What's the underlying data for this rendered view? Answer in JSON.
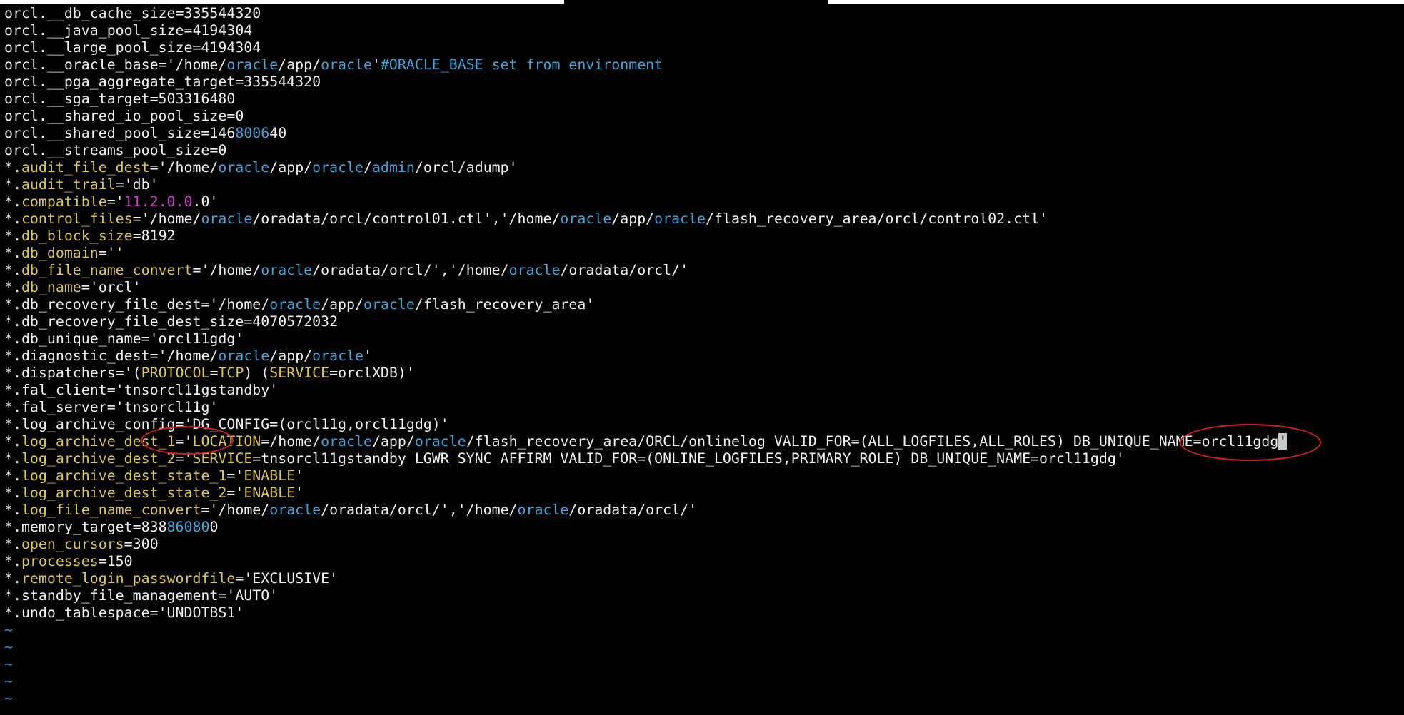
{
  "lines": [
    {
      "segments": [
        {
          "t": "orcl.__db_cache_size=335544320",
          "c": "w"
        }
      ]
    },
    {
      "segments": [
        {
          "t": "orcl.__java_pool_size=4194304",
          "c": "w"
        }
      ]
    },
    {
      "segments": [
        {
          "t": "orcl.__large_pool_size=4194304",
          "c": "w"
        }
      ]
    },
    {
      "segments": [
        {
          "t": "orcl.__oracle_base='/home/",
          "c": "w"
        },
        {
          "t": "oracle",
          "c": "c"
        },
        {
          "t": "/app/",
          "c": "w"
        },
        {
          "t": "oracle",
          "c": "c"
        },
        {
          "t": "'",
          "c": "w"
        },
        {
          "t": "#ORACLE_BASE set from environment",
          "c": "c"
        }
      ]
    },
    {
      "segments": [
        {
          "t": "orcl.__pga_aggregate_target=335544320",
          "c": "w"
        }
      ]
    },
    {
      "segments": [
        {
          "t": "orcl.__sga_target=503316480",
          "c": "w"
        }
      ]
    },
    {
      "segments": [
        {
          "t": "orcl.__shared_io_pool_size=0",
          "c": "w"
        }
      ]
    },
    {
      "segments": [
        {
          "t": "orcl.__shared_pool_size=146",
          "c": "w"
        },
        {
          "t": "8006",
          "c": "c"
        },
        {
          "t": "40",
          "c": "w"
        }
      ]
    },
    {
      "segments": [
        {
          "t": "orcl.__streams_pool_size=0",
          "c": "w"
        }
      ]
    },
    {
      "segments": [
        {
          "t": "*.",
          "c": "w"
        },
        {
          "t": "audit_file_dest",
          "c": "y"
        },
        {
          "t": "='/home/",
          "c": "w"
        },
        {
          "t": "oracle",
          "c": "c"
        },
        {
          "t": "/app/",
          "c": "w"
        },
        {
          "t": "oracle",
          "c": "c"
        },
        {
          "t": "/",
          "c": "w"
        },
        {
          "t": "admin",
          "c": "c"
        },
        {
          "t": "/orcl/adump'",
          "c": "w"
        }
      ]
    },
    {
      "segments": [
        {
          "t": "*.",
          "c": "w"
        },
        {
          "t": "audit_trail",
          "c": "y"
        },
        {
          "t": "='db'",
          "c": "w"
        }
      ]
    },
    {
      "segments": [
        {
          "t": "*.",
          "c": "w"
        },
        {
          "t": "compatible",
          "c": "y"
        },
        {
          "t": "='",
          "c": "w"
        },
        {
          "t": "11.2.0.0",
          "c": "m"
        },
        {
          "t": ".0'",
          "c": "w"
        }
      ]
    },
    {
      "segments": [
        {
          "t": "*.",
          "c": "w"
        },
        {
          "t": "control_files",
          "c": "y"
        },
        {
          "t": "='/home/",
          "c": "w"
        },
        {
          "t": "oracle",
          "c": "c"
        },
        {
          "t": "/oradata/orcl/control01.ctl','/home/",
          "c": "w"
        },
        {
          "t": "oracle",
          "c": "c"
        },
        {
          "t": "/app/",
          "c": "w"
        },
        {
          "t": "oracle",
          "c": "c"
        },
        {
          "t": "/flash_recovery_area/orcl/control02.ctl'",
          "c": "w"
        }
      ]
    },
    {
      "segments": [
        {
          "t": "*.",
          "c": "w"
        },
        {
          "t": "db_block_size",
          "c": "y"
        },
        {
          "t": "=8192",
          "c": "w"
        }
      ]
    },
    {
      "segments": [
        {
          "t": "*.",
          "c": "w"
        },
        {
          "t": "db_domain",
          "c": "y"
        },
        {
          "t": "=''",
          "c": "w"
        }
      ]
    },
    {
      "segments": [
        {
          "t": "*.",
          "c": "w"
        },
        {
          "t": "db_file_name_convert",
          "c": "y"
        },
        {
          "t": "='/home/",
          "c": "w"
        },
        {
          "t": "oracle",
          "c": "c"
        },
        {
          "t": "/oradata/orcl/','/home/",
          "c": "w"
        },
        {
          "t": "oracle",
          "c": "c"
        },
        {
          "t": "/oradata/orcl/'",
          "c": "w"
        }
      ]
    },
    {
      "segments": [
        {
          "t": "*.",
          "c": "w"
        },
        {
          "t": "db_name",
          "c": "y"
        },
        {
          "t": "='orcl'",
          "c": "w"
        }
      ]
    },
    {
      "segments": [
        {
          "t": "*.",
          "c": "w"
        },
        {
          "t": "db_recovery_file_dest",
          "c": "w"
        },
        {
          "t": "='/home/",
          "c": "w"
        },
        {
          "t": "oracle",
          "c": "c"
        },
        {
          "t": "/app/",
          "c": "w"
        },
        {
          "t": "oracle",
          "c": "c"
        },
        {
          "t": "/flash_recovery_area'",
          "c": "w"
        }
      ]
    },
    {
      "segments": [
        {
          "t": "*.",
          "c": "w"
        },
        {
          "t": "db_recovery_file_dest_size",
          "c": "w"
        },
        {
          "t": "=4070572032",
          "c": "w"
        }
      ]
    },
    {
      "segments": [
        {
          "t": "*.",
          "c": "w"
        },
        {
          "t": "db_unique_name",
          "c": "w"
        },
        {
          "t": "='orcl11gdg'",
          "c": "w"
        }
      ]
    },
    {
      "segments": [
        {
          "t": "*.",
          "c": "w"
        },
        {
          "t": "diagnostic_dest",
          "c": "w"
        },
        {
          "t": "='/home/",
          "c": "w"
        },
        {
          "t": "oracle",
          "c": "c"
        },
        {
          "t": "/app/",
          "c": "w"
        },
        {
          "t": "oracle",
          "c": "c"
        },
        {
          "t": "'",
          "c": "w"
        }
      ]
    },
    {
      "segments": [
        {
          "t": "*.",
          "c": "w"
        },
        {
          "t": "dispatchers",
          "c": "w"
        },
        {
          "t": "='(",
          "c": "w"
        },
        {
          "t": "PROTOCOL",
          "c": "y"
        },
        {
          "t": "=",
          "c": "w"
        },
        {
          "t": "TCP",
          "c": "y"
        },
        {
          "t": ") (",
          "c": "w"
        },
        {
          "t": "SERVICE",
          "c": "y"
        },
        {
          "t": "=orclXDB)'",
          "c": "w"
        }
      ]
    },
    {
      "segments": [
        {
          "t": "*.",
          "c": "w"
        },
        {
          "t": "fal_client",
          "c": "w"
        },
        {
          "t": "='tnsorcl11gstandby'",
          "c": "w"
        }
      ]
    },
    {
      "segments": [
        {
          "t": "*.",
          "c": "w"
        },
        {
          "t": "fal_server",
          "c": "w"
        },
        {
          "t": "='tnsorcl11g'",
          "c": "w"
        }
      ]
    },
    {
      "segments": [
        {
          "t": "*.",
          "c": "w"
        },
        {
          "t": "log_archive_config",
          "c": "w"
        },
        {
          "t": "='DG_CONFIG=(orcl11g,orcl11gdg)'",
          "c": "w"
        }
      ]
    },
    {
      "segments": [
        {
          "t": "*.",
          "c": "w"
        },
        {
          "t": "log_archive_dest_1",
          "c": "y"
        },
        {
          "t": "='",
          "c": "w"
        },
        {
          "t": "LOCATION",
          "c": "y"
        },
        {
          "t": "=/home/",
          "c": "w"
        },
        {
          "t": "oracle",
          "c": "c"
        },
        {
          "t": "/app/",
          "c": "w"
        },
        {
          "t": "oracle",
          "c": "c"
        },
        {
          "t": "/flash_recovery_area/ORCL/onlinelog VALID_FOR=(ALL_LOGFILES,ALL_ROLES) DB_UNIQUE_NAME=orcl11gdg",
          "c": "w"
        },
        {
          "t": "'",
          "c": "cursor"
        }
      ]
    },
    {
      "segments": [
        {
          "t": "*.",
          "c": "w"
        },
        {
          "t": "log_archive_dest_2",
          "c": "y"
        },
        {
          "t": "='",
          "c": "w"
        },
        {
          "t": "SERVICE",
          "c": "y"
        },
        {
          "t": "=tnsorcl11gstandby LGWR SYNC AFFIRM VALID_FOR=(ONLINE_LOGFILES,PRIMARY_ROLE) DB_UNIQUE_NAME=orcl11gdg'",
          "c": "w"
        }
      ]
    },
    {
      "segments": [
        {
          "t": "*.",
          "c": "w"
        },
        {
          "t": "log_archive_dest_state_1",
          "c": "y"
        },
        {
          "t": "='",
          "c": "w"
        },
        {
          "t": "ENABLE",
          "c": "y"
        },
        {
          "t": "'",
          "c": "w"
        }
      ]
    },
    {
      "segments": [
        {
          "t": "*.",
          "c": "w"
        },
        {
          "t": "log_archive_dest_state_2",
          "c": "y"
        },
        {
          "t": "='",
          "c": "w"
        },
        {
          "t": "ENABLE",
          "c": "y"
        },
        {
          "t": "'",
          "c": "w"
        }
      ]
    },
    {
      "segments": [
        {
          "t": "*.",
          "c": "w"
        },
        {
          "t": "log_file_name_convert",
          "c": "y"
        },
        {
          "t": "='/home/",
          "c": "w"
        },
        {
          "t": "oracle",
          "c": "c"
        },
        {
          "t": "/oradata/orcl/','/home/",
          "c": "w"
        },
        {
          "t": "oracle",
          "c": "c"
        },
        {
          "t": "/oradata/orcl/'",
          "c": "w"
        }
      ]
    },
    {
      "segments": [
        {
          "t": "*.",
          "c": "w"
        },
        {
          "t": "memory_target",
          "c": "w"
        },
        {
          "t": "=838",
          "c": "w"
        },
        {
          "t": "86080",
          "c": "c"
        },
        {
          "t": "0",
          "c": "w"
        }
      ]
    },
    {
      "segments": [
        {
          "t": "*.",
          "c": "w"
        },
        {
          "t": "open_cursors",
          "c": "y"
        },
        {
          "t": "=300",
          "c": "w"
        }
      ]
    },
    {
      "segments": [
        {
          "t": "*.",
          "c": "w"
        },
        {
          "t": "processes",
          "c": "y"
        },
        {
          "t": "=150",
          "c": "w"
        }
      ]
    },
    {
      "segments": [
        {
          "t": "*.",
          "c": "w"
        },
        {
          "t": "remote_login_passwordfile",
          "c": "y"
        },
        {
          "t": "='EXCLUSIVE'",
          "c": "w"
        }
      ]
    },
    {
      "segments": [
        {
          "t": "*.",
          "c": "w"
        },
        {
          "t": "standby_file_management",
          "c": "w"
        },
        {
          "t": "='AUTO'",
          "c": "w"
        }
      ]
    },
    {
      "segments": [
        {
          "t": "*.",
          "c": "w"
        },
        {
          "t": "undo_tablespace",
          "c": "w"
        },
        {
          "t": "='UNDOTBS1'",
          "c": "w"
        }
      ]
    }
  ],
  "empty_line_marker": "~",
  "empty_line_count": 5,
  "colors": {
    "background": "#000000",
    "text": "#f0f0f0",
    "parameter": "#dcc84a",
    "path_keyword": "#3aa6dc",
    "number_literal": "#d040d0",
    "annotation_circle": "#d02020"
  }
}
